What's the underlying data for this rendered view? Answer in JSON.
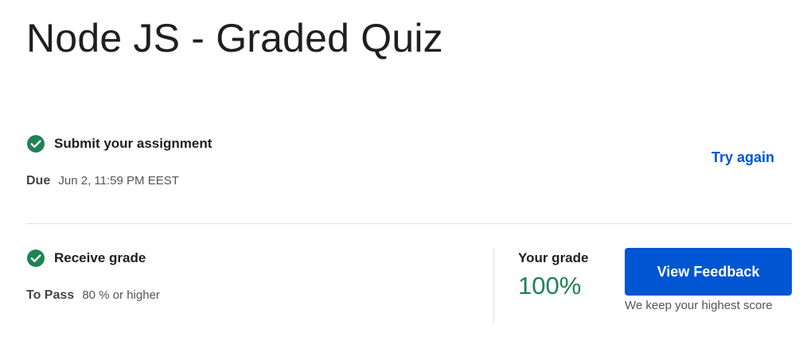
{
  "page": {
    "title": "Node JS - Graded Quiz"
  },
  "submit_step": {
    "icon": "check-circle-icon",
    "title": "Submit your assignment",
    "due_label": "Due",
    "due_value": "Jun 2, 11:59 PM EEST",
    "try_again_label": "Try again"
  },
  "grade_step": {
    "icon": "check-circle-icon",
    "title": "Receive grade",
    "pass_label": "To Pass",
    "pass_value": "80 % or higher",
    "your_grade_label": "Your grade",
    "your_grade_value": "100%",
    "view_feedback_label": "View Feedback",
    "keep_score_note": "We keep your highest score"
  },
  "colors": {
    "success_green": "#1f8354",
    "accent_blue": "#0056d2",
    "text_primary": "#1f1f1f",
    "text_secondary": "#555555",
    "divider": "#e1e1e1"
  }
}
